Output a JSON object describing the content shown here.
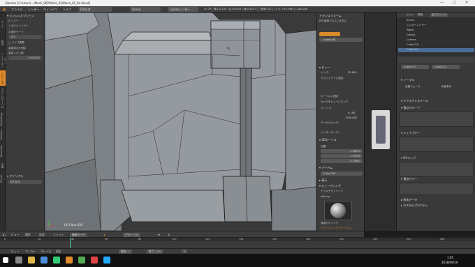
{
  "window": {
    "title": "Blender [C:\\Users\\...\\Mech_SRP\\Mech_02\\Mech_02_fin.blend]",
    "controls": [
      "—",
      "□",
      "✕"
    ]
  },
  "info_header": {
    "menus": [
      "ファイル",
      "レンダー",
      "ウィンドウ",
      "ヘルプ"
    ],
    "layout": "Default",
    "scene": "Scene",
    "engine": "Cyclesレンダー",
    "stats": "v2.79 | 頂点:2/104 | 辺:0/3929 | 面:0/1617 | 三角面:3211 | メモリ:45.06M | Cube.030"
  },
  "tool_tabs": [
    "ツール",
    "作成",
    "シェーディング/UV",
    "オプション",
    "グリースペンシル",
    "Retopology",
    "Hardops",
    "Boxcutter",
    "表示",
    "Extras"
  ],
  "tool_shelf": {
    "section1": "▾ メッシュオプション",
    "row1": "X ミラー",
    "row2": "トポロジーミラー",
    "section2": "辺選択モード:",
    "mode": "タグ",
    "row3": "□ ライブ展開",
    "row4": "重複頂点を削除",
    "row5": "重複しきい値",
    "value": "0.001000",
    "section3": "▾ マテリアル",
    "option": "切り抜き"
  },
  "viewport": {
    "label": "(0) Cube.030",
    "header_menus": [
      "ビュー",
      "選択",
      "追加",
      "メッシュ",
      "編集モード",
      "グローバル"
    ]
  },
  "n_panel": {
    "top_tabs": [
      "トランスフォーム"
    ],
    "rows": [
      {
        "label": "何も選択されていません",
        "value": ""
      },
      {
        "label": "Cube.030",
        "value": ""
      }
    ],
    "view_section": "▾ ビュー",
    "lens_label": "レンズ:",
    "lens_value": "35.000",
    "lock_label": "オブジェクトに固定:",
    "cursor_label": "カーソルに固定",
    "cam_label": "カメラをビューにロック",
    "clip_label": "クリップ:",
    "clip_start": "0.100",
    "clip_end": "1000.000",
    "local_cam": "ローカルカメラ:",
    "render_border": "レンダーボーダー",
    "cursor_section": "▾ 3Dカーソル",
    "loc_label": "位置:",
    "x": "1.98904",
    "y": "1.59769",
    "z": "0.13601",
    "item_section": "▾ アイテム",
    "item_name": "Cube.030",
    "display_section": "▸ 表示",
    "shading_section": "▾ シェーディング",
    "matcap_label": "テクスチャソリッド",
    "matcap": "Matcap",
    "bf_label": "背面のカリング",
    "wire_label": "隠面ワイヤ",
    "ao_label": "アンビエントオクルージョン"
  },
  "outliner": {
    "header": [
      "ビュー",
      "検索",
      "全てのシーン"
    ],
    "rows": [
      "Scene",
      "レンダーレイヤー",
      "World",
      "Ghost1",
      "Camera",
      "Cube.018",
      "Cube.019"
    ]
  },
  "properties": {
    "object": "Cube.017",
    "data": "Cube.017",
    "sections": [
      "▾ ノーマル",
      "自動スムーズ",
      "両面表示",
      "▾ テクスチャスペース",
      "▾ 頂点グループ",
      "▾ シェイプキー",
      "▾ UVマップ",
      "▾ 頂点カラー",
      "▸ 形状データ",
      "▸ カスタムプロパティ"
    ]
  },
  "timeline": {
    "menus": [
      "ビュー",
      "マーカー",
      "フレーム",
      "再生"
    ],
    "start_label": "開始:",
    "start": "1",
    "end_label": "終了:",
    "end": "250",
    "current": "1",
    "ticks": [
      "0",
      "20",
      "40",
      "60",
      "80",
      "100",
      "120",
      "140",
      "160",
      "180",
      "200",
      "220",
      "240",
      "260"
    ]
  },
  "taskbar": {
    "time": "1:05",
    "date": "2018/09/19"
  },
  "colors": {
    "accent": "#d98a2b",
    "selection": "#4a6d95",
    "mesh": "#8e9399"
  }
}
